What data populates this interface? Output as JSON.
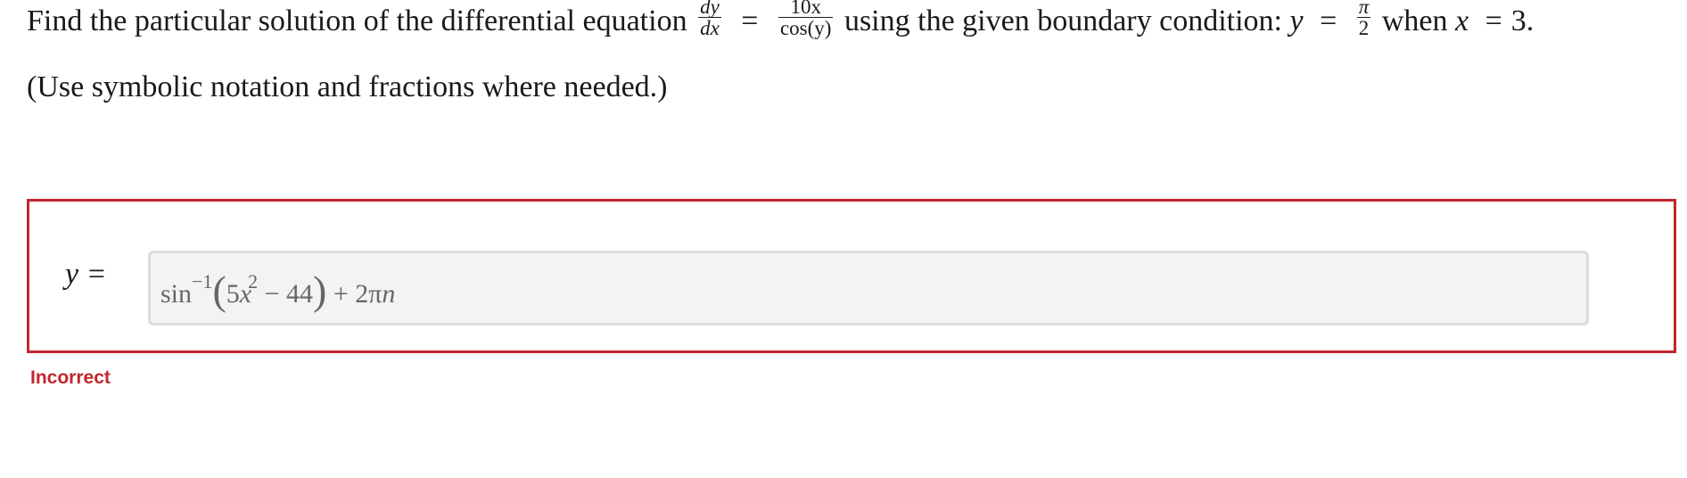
{
  "question": {
    "prefix": "Find the particular solution of the differential equation",
    "lhs_numerator": "dy",
    "lhs_denominator": "dx",
    "equals": "=",
    "rhs_numerator": "10x",
    "rhs_denominator": "cos(y)",
    "middle_text": "using the given boundary condition:",
    "cond_var": "y",
    "cond_equals": "=",
    "cond_numerator": "π",
    "cond_denominator": "2",
    "when_text": "when",
    "x_var": "x",
    "x_equals": "=",
    "x_value": "3."
  },
  "hint": "(Use symbolic notation and fractions where needed.)",
  "answer": {
    "label": "y =",
    "expression": {
      "func": "sin",
      "inverse_exp": "−1",
      "open_paren": "(",
      "coef": "5",
      "var": "x",
      "power": "2",
      "minus_term": " − 44",
      "close_paren": ")",
      "tail": " + 2π",
      "tail_var": "n"
    }
  },
  "status": "Incorrect",
  "colors": {
    "error": "#c1272d",
    "input_background": "#f3f3f3",
    "input_border": "#dcdcdc"
  }
}
